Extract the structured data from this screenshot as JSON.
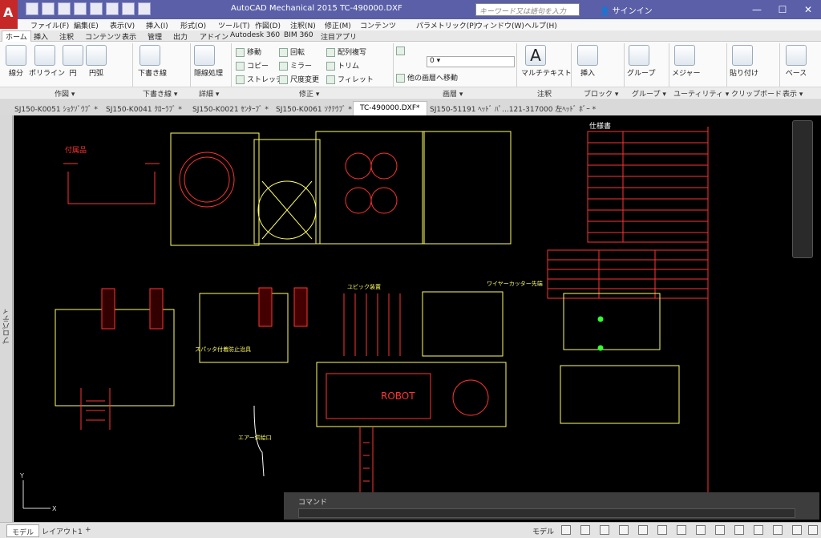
{
  "app": {
    "logo_letter": "A",
    "title": "AutoCAD Mechanical 2015    TC-490000.DXF"
  },
  "search": {
    "placeholder": "キーワード又は語句を入力"
  },
  "signin": {
    "label": "サインイン"
  },
  "window_buttons": {
    "minimize": "—",
    "maximize": "☐",
    "close": "✕"
  },
  "menu": [
    "ファイル(F)",
    "編集(E)",
    "表示(V)",
    "挿入(I)",
    "形式(O)",
    "ツール(T)",
    "作図(D)",
    "注釈(N)",
    "修正(M)",
    "コンテンツ",
    "パラメトリック(P)",
    "ウィンドウ(W)",
    "ヘルプ(H)"
  ],
  "ribbon_tabs": [
    "ホーム",
    "挿入",
    "注釈",
    "コンテンツ",
    "表示",
    "管理",
    "出力",
    "アドイン",
    "Autodesk 360",
    "BIM 360",
    "注目アプリ"
  ],
  "ribbon": {
    "draw": {
      "line": "線分",
      "polyline": "ポリライン",
      "circle": "円",
      "arc": "円弧",
      "title": "作図 ▾"
    },
    "construction": {
      "line": "下書き線",
      "title": "下書き線 ▾"
    },
    "detail": {
      "hidden": "隠線処理",
      "title": "詳細 ▾"
    },
    "modify": {
      "move": "移動",
      "rotate": "回転",
      "array": "配列複写",
      "copy": "コピー",
      "mirror": "ミラー",
      "trim": "トリム",
      "stretch": "ストレッチ",
      "scale": "尺度変更",
      "fillet": "フィレット",
      "title": "修正 ▾"
    },
    "layers": {
      "current": "0",
      "move_to_layer": "他の画層へ移動",
      "title": "画層 ▾"
    },
    "annotation": {
      "mtext": "マルチテキスト",
      "title": "注釈"
    },
    "block": {
      "insert": "挿入",
      "title": "ブロック ▾"
    },
    "group": {
      "group": "グループ",
      "title": "グループ ▾"
    },
    "utility": {
      "measure": "メジャー",
      "title": "ユーティリティ ▾"
    },
    "clipboard": {
      "paste": "貼り付け",
      "title": "クリップボード"
    },
    "view": {
      "base": "ベース",
      "title": "表示 ▾"
    }
  },
  "doc_tabs": [
    "SJ150-K0051 ｼｮｸｿﾞｳﾌﾞ *",
    "SJ150-K0041 ｸﾛｰﾗﾌﾞ *",
    "SJ150-K0021 ｾﾝﾀｰﾌﾞ *",
    "SJ150-K0061 ｿｸﾃｳﾌﾞ *",
    "TC-490000.DXF*",
    "SJ150-51191 ﾍｯﾄﾞ ﾊﾟ...121-317000 左ﾍｯﾄﾞ ﾎﾞｰ *"
  ],
  "active_doc_index": 4,
  "palette_left": {
    "label": "プロパティ"
  },
  "drawing_labels": {
    "accessories": "付属品",
    "spec": "仕様書",
    "robot_logo": "ROBOT",
    "hose_label": "エアー供給口",
    "wire_label": "ワイヤーカッター先端",
    "ubic": "ユビック装置",
    "splash": "スパッタ付着防止治具"
  },
  "command": {
    "label": "コマンド",
    "placeholder": ""
  },
  "status": {
    "model_tab": "モデル",
    "layout_tab": "レイアウト1",
    "add": "+",
    "model_label": "モデル"
  },
  "colors": {
    "title_bar": "#5a5fa8",
    "canvas": "#000000",
    "logo_red": "#c62828"
  }
}
